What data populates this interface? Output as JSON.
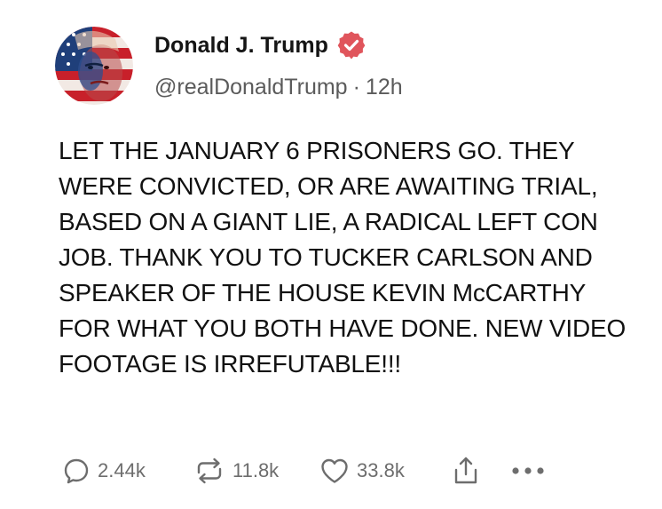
{
  "post": {
    "author": {
      "display_name": "Donald J. Trump",
      "verified": true,
      "verified_color": "#e0555c",
      "handle": "@realDonaldTrump",
      "separator": "·",
      "time": "12h"
    },
    "text": "LET THE JANUARY 6 PRISONERS GO. THEY WERE CONVICTED, OR ARE AWAITING TRIAL, BASED ON A GIANT LIE, A RADICAL LEFT CON JOB. THANK YOU TO TUCKER CARLSON AND SPEAKER OF THE HOUSE KEVIN McCARTHY FOR WHAT YOU BOTH HAVE DONE. NEW VIDEO FOOTAGE IS IRREFUTABLE!!!",
    "actions": {
      "replies": {
        "icon": "reply-icon",
        "count": "2.44k"
      },
      "reposts": {
        "icon": "repost-icon",
        "count": "11.8k"
      },
      "likes": {
        "icon": "heart-icon",
        "count": "33.8k"
      },
      "share": {
        "icon": "share-icon"
      },
      "more": {
        "icon": "more-icon"
      }
    }
  }
}
